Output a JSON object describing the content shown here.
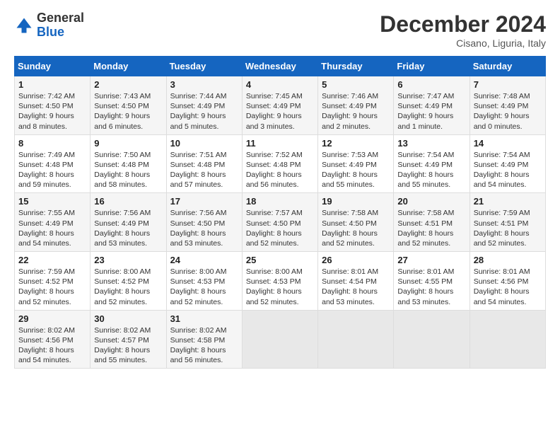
{
  "header": {
    "logo_general": "General",
    "logo_blue": "Blue",
    "month_title": "December 2024",
    "location": "Cisano, Liguria, Italy"
  },
  "days_of_week": [
    "Sunday",
    "Monday",
    "Tuesday",
    "Wednesday",
    "Thursday",
    "Friday",
    "Saturday"
  ],
  "weeks": [
    [
      {
        "day": "1",
        "sunrise": "Sunrise: 7:42 AM",
        "sunset": "Sunset: 4:50 PM",
        "daylight": "Daylight: 9 hours and 8 minutes."
      },
      {
        "day": "2",
        "sunrise": "Sunrise: 7:43 AM",
        "sunset": "Sunset: 4:50 PM",
        "daylight": "Daylight: 9 hours and 6 minutes."
      },
      {
        "day": "3",
        "sunrise": "Sunrise: 7:44 AM",
        "sunset": "Sunset: 4:49 PM",
        "daylight": "Daylight: 9 hours and 5 minutes."
      },
      {
        "day": "4",
        "sunrise": "Sunrise: 7:45 AM",
        "sunset": "Sunset: 4:49 PM",
        "daylight": "Daylight: 9 hours and 3 minutes."
      },
      {
        "day": "5",
        "sunrise": "Sunrise: 7:46 AM",
        "sunset": "Sunset: 4:49 PM",
        "daylight": "Daylight: 9 hours and 2 minutes."
      },
      {
        "day": "6",
        "sunrise": "Sunrise: 7:47 AM",
        "sunset": "Sunset: 4:49 PM",
        "daylight": "Daylight: 9 hours and 1 minute."
      },
      {
        "day": "7",
        "sunrise": "Sunrise: 7:48 AM",
        "sunset": "Sunset: 4:49 PM",
        "daylight": "Daylight: 9 hours and 0 minutes."
      }
    ],
    [
      {
        "day": "8",
        "sunrise": "Sunrise: 7:49 AM",
        "sunset": "Sunset: 4:48 PM",
        "daylight": "Daylight: 8 hours and 59 minutes."
      },
      {
        "day": "9",
        "sunrise": "Sunrise: 7:50 AM",
        "sunset": "Sunset: 4:48 PM",
        "daylight": "Daylight: 8 hours and 58 minutes."
      },
      {
        "day": "10",
        "sunrise": "Sunrise: 7:51 AM",
        "sunset": "Sunset: 4:48 PM",
        "daylight": "Daylight: 8 hours and 57 minutes."
      },
      {
        "day": "11",
        "sunrise": "Sunrise: 7:52 AM",
        "sunset": "Sunset: 4:48 PM",
        "daylight": "Daylight: 8 hours and 56 minutes."
      },
      {
        "day": "12",
        "sunrise": "Sunrise: 7:53 AM",
        "sunset": "Sunset: 4:49 PM",
        "daylight": "Daylight: 8 hours and 55 minutes."
      },
      {
        "day": "13",
        "sunrise": "Sunrise: 7:54 AM",
        "sunset": "Sunset: 4:49 PM",
        "daylight": "Daylight: 8 hours and 55 minutes."
      },
      {
        "day": "14",
        "sunrise": "Sunrise: 7:54 AM",
        "sunset": "Sunset: 4:49 PM",
        "daylight": "Daylight: 8 hours and 54 minutes."
      }
    ],
    [
      {
        "day": "15",
        "sunrise": "Sunrise: 7:55 AM",
        "sunset": "Sunset: 4:49 PM",
        "daylight": "Daylight: 8 hours and 54 minutes."
      },
      {
        "day": "16",
        "sunrise": "Sunrise: 7:56 AM",
        "sunset": "Sunset: 4:49 PM",
        "daylight": "Daylight: 8 hours and 53 minutes."
      },
      {
        "day": "17",
        "sunrise": "Sunrise: 7:56 AM",
        "sunset": "Sunset: 4:50 PM",
        "daylight": "Daylight: 8 hours and 53 minutes."
      },
      {
        "day": "18",
        "sunrise": "Sunrise: 7:57 AM",
        "sunset": "Sunset: 4:50 PM",
        "daylight": "Daylight: 8 hours and 52 minutes."
      },
      {
        "day": "19",
        "sunrise": "Sunrise: 7:58 AM",
        "sunset": "Sunset: 4:50 PM",
        "daylight": "Daylight: 8 hours and 52 minutes."
      },
      {
        "day": "20",
        "sunrise": "Sunrise: 7:58 AM",
        "sunset": "Sunset: 4:51 PM",
        "daylight": "Daylight: 8 hours and 52 minutes."
      },
      {
        "day": "21",
        "sunrise": "Sunrise: 7:59 AM",
        "sunset": "Sunset: 4:51 PM",
        "daylight": "Daylight: 8 hours and 52 minutes."
      }
    ],
    [
      {
        "day": "22",
        "sunrise": "Sunrise: 7:59 AM",
        "sunset": "Sunset: 4:52 PM",
        "daylight": "Daylight: 8 hours and 52 minutes."
      },
      {
        "day": "23",
        "sunrise": "Sunrise: 8:00 AM",
        "sunset": "Sunset: 4:52 PM",
        "daylight": "Daylight: 8 hours and 52 minutes."
      },
      {
        "day": "24",
        "sunrise": "Sunrise: 8:00 AM",
        "sunset": "Sunset: 4:53 PM",
        "daylight": "Daylight: 8 hours and 52 minutes."
      },
      {
        "day": "25",
        "sunrise": "Sunrise: 8:00 AM",
        "sunset": "Sunset: 4:53 PM",
        "daylight": "Daylight: 8 hours and 52 minutes."
      },
      {
        "day": "26",
        "sunrise": "Sunrise: 8:01 AM",
        "sunset": "Sunset: 4:54 PM",
        "daylight": "Daylight: 8 hours and 53 minutes."
      },
      {
        "day": "27",
        "sunrise": "Sunrise: 8:01 AM",
        "sunset": "Sunset: 4:55 PM",
        "daylight": "Daylight: 8 hours and 53 minutes."
      },
      {
        "day": "28",
        "sunrise": "Sunrise: 8:01 AM",
        "sunset": "Sunset: 4:56 PM",
        "daylight": "Daylight: 8 hours and 54 minutes."
      }
    ],
    [
      {
        "day": "29",
        "sunrise": "Sunrise: 8:02 AM",
        "sunset": "Sunset: 4:56 PM",
        "daylight": "Daylight: 8 hours and 54 minutes."
      },
      {
        "day": "30",
        "sunrise": "Sunrise: 8:02 AM",
        "sunset": "Sunset: 4:57 PM",
        "daylight": "Daylight: 8 hours and 55 minutes."
      },
      {
        "day": "31",
        "sunrise": "Sunrise: 8:02 AM",
        "sunset": "Sunset: 4:58 PM",
        "daylight": "Daylight: 8 hours and 56 minutes."
      },
      {
        "day": "",
        "sunrise": "",
        "sunset": "",
        "daylight": ""
      },
      {
        "day": "",
        "sunrise": "",
        "sunset": "",
        "daylight": ""
      },
      {
        "day": "",
        "sunrise": "",
        "sunset": "",
        "daylight": ""
      },
      {
        "day": "",
        "sunrise": "",
        "sunset": "",
        "daylight": ""
      }
    ]
  ]
}
